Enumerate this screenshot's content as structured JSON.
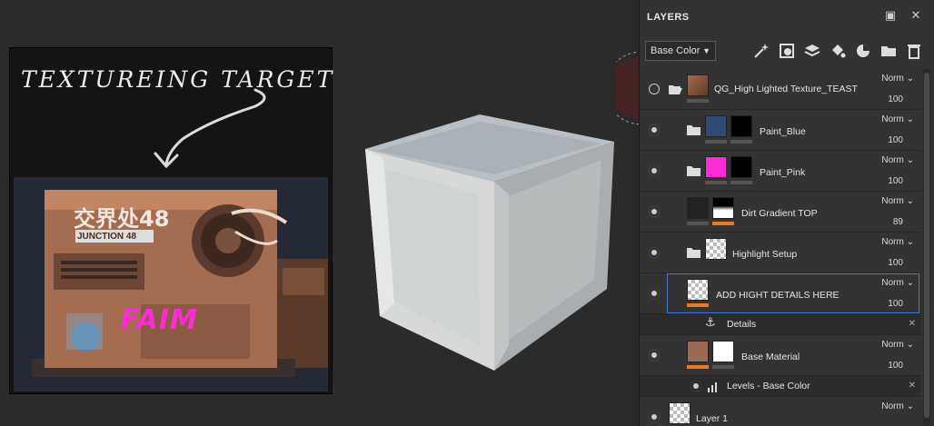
{
  "reference": {
    "title": "TEXTUREING TARGET",
    "sign_text": "交界处48",
    "sign_sub": "JUNCTION 48",
    "graffiti": "FAIM"
  },
  "panel": {
    "title": "LAYERS",
    "channel": "Base Color"
  },
  "layers": [
    {
      "name": "QG_High Lighted Texture_TEAST",
      "blend": "Norm",
      "opacity": "100"
    },
    {
      "name": "Paint_Blue",
      "blend": "Norm",
      "opacity": "100"
    },
    {
      "name": "Paint_Pink",
      "blend": "Norm",
      "opacity": "100"
    },
    {
      "name": "Dirt Gradient TOP",
      "blend": "Norm",
      "opacity": "89"
    },
    {
      "name": "Highlight Setup",
      "blend": "Norm",
      "opacity": "100"
    },
    {
      "name": "ADD HIGHT DETAILS HERE",
      "blend": "Norm",
      "opacity": "100"
    },
    {
      "name": "Details"
    },
    {
      "name": "Base Material",
      "blend": "Norm",
      "opacity": "100"
    },
    {
      "name": "Levels - Base Color"
    },
    {
      "name": "Layer 1",
      "blend": "Norm"
    }
  ],
  "colors": {
    "accent_orange": "#ee7a1f",
    "selection_blue": "#3d7bd6",
    "pink": "#ff2bd6"
  }
}
